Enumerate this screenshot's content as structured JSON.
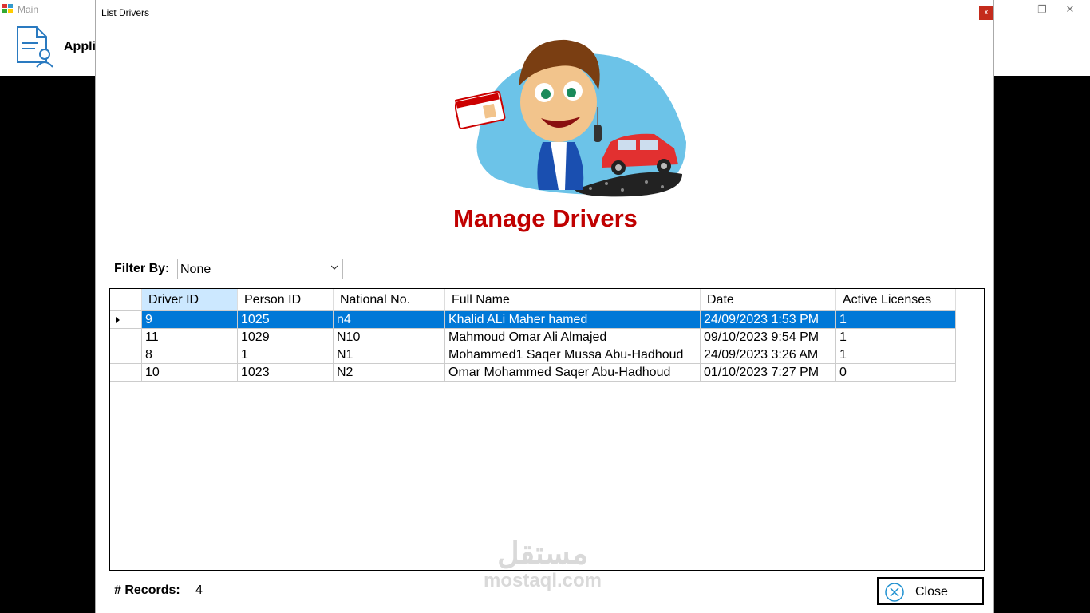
{
  "main_window": {
    "title": "Main",
    "toolbar_label": "Appli",
    "buttons": {
      "minimize": "—",
      "restore": "❐",
      "close": "✕"
    }
  },
  "dialog": {
    "title": "List Drivers",
    "close_glyph": "x",
    "heading": "Manage Drivers",
    "filter": {
      "label": "Filter By:",
      "selected": "None"
    },
    "grid": {
      "columns": [
        "Driver ID",
        "Person ID",
        "National No.",
        "Full Name",
        "Date",
        "Active Licenses"
      ],
      "rows": [
        [
          "9",
          "1025",
          "n4",
          "Khalid ALi Maher hamed",
          "24/09/2023 1:53 PM",
          "1"
        ],
        [
          "11",
          "1029",
          "N10",
          "Mahmoud Omar Ali Almajed",
          "09/10/2023 9:54 PM",
          "1"
        ],
        [
          "8",
          "1",
          "N1",
          "Mohammed1 Saqer Mussa Abu-Hadhoud",
          "24/09/2023 3:26 AM",
          "1"
        ],
        [
          "10",
          "1023",
          "N2",
          "Omar Mohammed Saqer Abu-Hadhoud",
          "01/10/2023 7:27 PM",
          "0"
        ]
      ]
    },
    "records": {
      "label": "# Records:",
      "count": "4"
    },
    "close_button": "Close",
    "watermark": {
      "arabic": "مستقل",
      "latin": "mostaql.com"
    }
  },
  "colors": {
    "accent_selected_row": "#0078d7",
    "header_selected": "#cce8ff",
    "title_red": "#c00000",
    "dialog_close_red": "#c42b1c"
  }
}
